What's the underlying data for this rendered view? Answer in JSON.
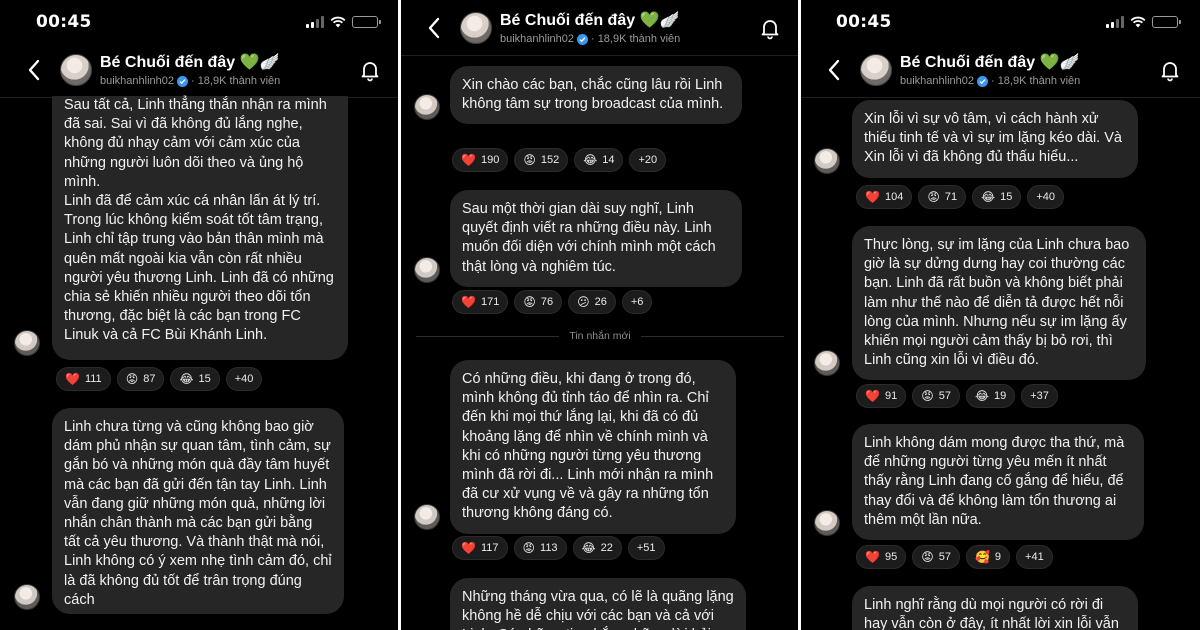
{
  "channel": {
    "title": "Bé Chuối đến đây 💚🪽",
    "username": "buikhanhlinh02",
    "members": "18,9K thành viên"
  },
  "status_time": "00:45",
  "divider_label": "Tin nhắn mới",
  "panel1": {
    "messages": [
      {
        "text": "Sau tất cả, Linh thẳng thắn nhận ra mình đã sai. Sai vì đã không đủ lắng nghe, không đủ nhạy cảm với cảm xúc của những người luôn dõi theo và ủng hộ mình.\nLinh đã để cảm xúc cá nhân lấn át lý trí. Trong lúc không kiểm soát tốt tâm trạng, Linh chỉ tập trung vào bản thân mình mà quên mất ngoài kia vẫn còn rất nhiều người yêu thương Linh. Linh đã có những chia sẻ khiến nhiều người theo dõi tổn thương, đặc biệt là các bạn trong FC Linuk và cả FC Bùi Khánh Linh.",
        "reactions": [
          {
            "emoji": "❤️",
            "count": "111"
          },
          {
            "emoji": "😡",
            "count": "87"
          },
          {
            "emoji": "😂",
            "count": "15"
          },
          {
            "emoji": "",
            "count": "+40"
          }
        ]
      },
      {
        "text": "Linh chưa từng và cũng không bao giờ dám phủ nhận sự quan tâm, tình cảm, sự gắn bó và những món quà đầy tâm huyết mà các bạn đã gửi đến tận tay Linh. Linh vẫn đang giữ những món quà, những lời nhắn chân thành mà các bạn gửi bằng tất cả yêu thương. Và thành thật mà nói, Linh không có ý xem nhẹ tình cảm đó, chỉ là đã không đủ tốt để trân trọng đúng cách"
      }
    ]
  },
  "panel2": {
    "messages": [
      {
        "text": "Xin chào các bạn, chắc cũng lâu rồi Linh không tâm sự trong broadcast của mình.",
        "reactions": [
          {
            "emoji": "❤️",
            "count": "190"
          },
          {
            "emoji": "😡",
            "count": "152"
          },
          {
            "emoji": "😂",
            "count": "14"
          },
          {
            "emoji": "",
            "count": "+20"
          }
        ]
      },
      {
        "text": "Sau một thời gian dài suy nghĩ, Linh quyết định viết ra những điều này. Linh muốn đối diện với chính mình một cách thật lòng và nghiêm túc.",
        "reactions": [
          {
            "emoji": "❤️",
            "count": "171"
          },
          {
            "emoji": "😡",
            "count": "76"
          },
          {
            "emoji": "😕",
            "count": "26"
          },
          {
            "emoji": "",
            "count": "+6"
          }
        ]
      },
      {
        "text": "Có những điều, khi đang ở trong đó, mình không đủ tỉnh táo để nhìn ra. Chỉ đến khi mọi thứ lắng lại, khi đã có đủ khoảng lặng để nhìn về chính mình và khi có những người từng yêu thương mình đã rời đi... Linh mới nhận ra mình đã cư xử vụng về và gây ra những tổn thương không đáng có.",
        "reactions": [
          {
            "emoji": "❤️",
            "count": "117"
          },
          {
            "emoji": "😡",
            "count": "113"
          },
          {
            "emoji": "😂",
            "count": "22"
          },
          {
            "emoji": "",
            "count": "+51"
          }
        ]
      },
      {
        "text": "Những tháng vừa qua, có lẽ là quãng lặng không hề dễ chịu với các bạn và cả với Linh. Có những tin nhắn, những lời hỏi"
      }
    ]
  },
  "panel3": {
    "messages": [
      {
        "text": "Xin lỗi vì sự vô tâm, vì cách hành xử thiếu tinh tế và vì sự im lặng kéo dài. Và Xin lỗi vì đã không đủ thấu hiểu...",
        "reactions": [
          {
            "emoji": "❤️",
            "count": "104"
          },
          {
            "emoji": "😡",
            "count": "71"
          },
          {
            "emoji": "😂",
            "count": "15"
          },
          {
            "emoji": "",
            "count": "+40"
          }
        ]
      },
      {
        "text": "Thực lòng, sự im lặng của Linh chưa bao giờ là sự dửng dưng hay coi thường các bạn. Linh đã rất buồn và không biết phải làm như thế nào để diễn tả được hết nỗi lòng của mình. Nhưng nếu sự im lặng ấy khiến mọi người cảm thấy bị bỏ rơi, thì Linh cũng xin lỗi vì điều đó.",
        "reactions": [
          {
            "emoji": "❤️",
            "count": "91"
          },
          {
            "emoji": "😡",
            "count": "57"
          },
          {
            "emoji": "😂",
            "count": "19"
          },
          {
            "emoji": "",
            "count": "+37"
          }
        ]
      },
      {
        "text": "Linh không dám mong được tha thứ, mà để những người từng yêu mến ít nhất thấy rằng Linh đang cố gắng để hiểu, để thay đổi và để không làm tổn thương ai thêm một lần nữa.",
        "reactions": [
          {
            "emoji": "❤️",
            "count": "95"
          },
          {
            "emoji": "😡",
            "count": "57"
          },
          {
            "emoji": "🥰",
            "count": "9"
          },
          {
            "emoji": "",
            "count": "+41"
          }
        ]
      },
      {
        "text": "Linh nghĩ rằng dù mọi người có rời đi hay vẫn còn ở đây, ít nhất lời xin lỗi vẫn"
      }
    ]
  },
  "colors": {
    "background": "#000000",
    "bubble": "#262626",
    "verified": "#3897f0",
    "battery": "#ffd60a"
  },
  "icons": [
    "back-chevron-icon",
    "bell-icon",
    "verified-badge-icon",
    "signal-icon",
    "wifi-icon",
    "battery-icon"
  ]
}
